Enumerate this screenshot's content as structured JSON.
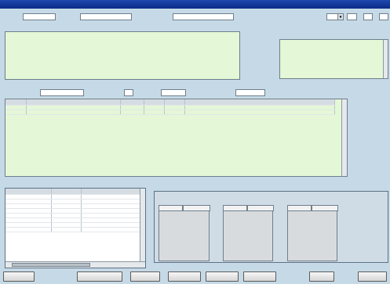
{
  "window": {
    "title": ""
  },
  "top_fields": [
    {
      "label": "",
      "value": ""
    },
    {
      "label": "",
      "value": ""
    },
    {
      "label": "",
      "value": ""
    },
    {
      "label": "",
      "value": ""
    }
  ],
  "designation_date": {
    "era": "",
    "year": "",
    "year_unit": "",
    "month": "",
    "month_unit": "",
    "day": ""
  },
  "history": {
    "label": "",
    "text": ""
  },
  "environment": {
    "label": "",
    "text": ""
  },
  "area_section": {
    "title": "",
    "public_area": {
      "label": "",
      "value": "",
      "unit": ""
    },
    "total_area": {
      "label": "",
      "value": "",
      "unit": ""
    },
    "actual_area": {
      "label": "",
      "value": "",
      "unit": ""
    },
    "planned_area": {
      "label": "",
      "value": "",
      "unit": ""
    }
  },
  "land_table": {
    "columns": [
      "",
      "",
      "",
      "",
      "",
      ""
    ],
    "rows": [
      [
        "",
        "",
        "",
        "",
        "",
        ""
      ],
      [
        "",
        "",
        "",
        "",
        "",
        ""
      ]
    ]
  },
  "laws_section": {
    "title": "",
    "columns": [
      "",
      "",
      ""
    ],
    "rows": [
      [
        "",
        "",
        ""
      ],
      [
        "",
        "",
        ""
      ],
      [
        "",
        "",
        ""
      ],
      [
        "",
        "",
        ""
      ],
      [
        "",
        "",
        ""
      ],
      [
        "",
        "",
        ""
      ],
      [
        "",
        "",
        ""
      ],
      [
        "",
        "",
        ""
      ]
    ]
  },
  "sub_tables": [
    {
      "title": "",
      "col1": "",
      "col2": ""
    },
    {
      "title": "",
      "col1": "",
      "col2": ""
    },
    {
      "title": "",
      "col1": "",
      "col2": ""
    }
  ],
  "buttons": {
    "b1": "",
    "b2": "",
    "b3": "",
    "b4": "",
    "b5": "",
    "b6": "",
    "b7": "",
    "b8": ""
  }
}
